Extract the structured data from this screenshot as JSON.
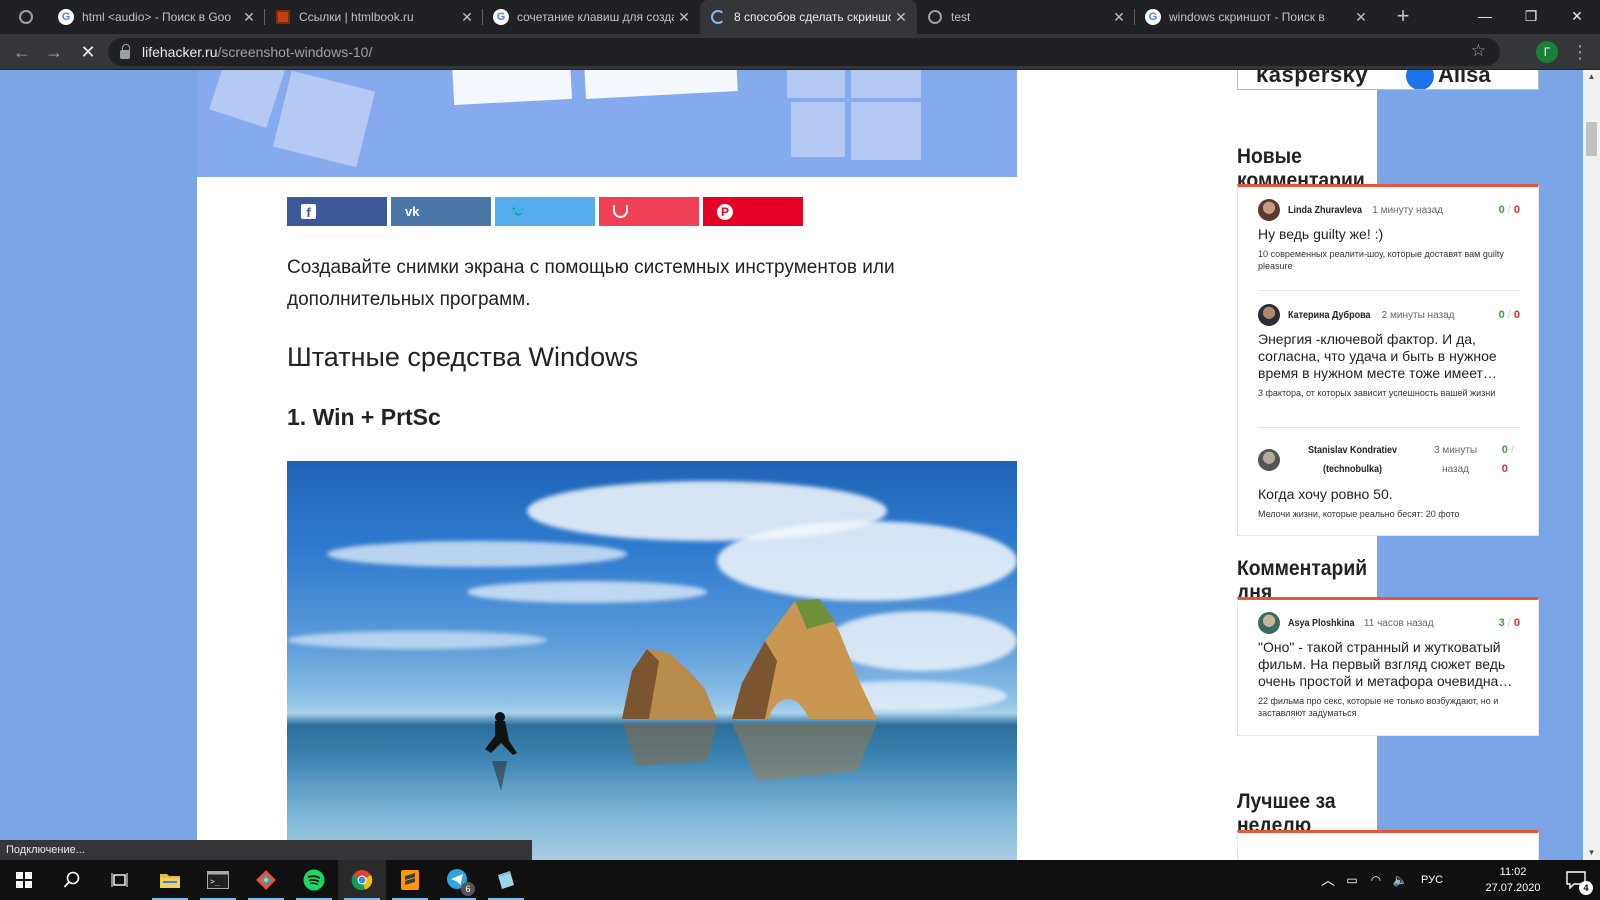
{
  "browser": {
    "tabs": [
      {
        "title": "html <audio> - Поиск в Goo",
        "icon": "google-icon",
        "active": false
      },
      {
        "title": "Ссылки | htmlbook.ru",
        "icon": "htmlbook-icon",
        "active": false
      },
      {
        "title": "сочетание клавиш для созда",
        "icon": "google-icon",
        "active": false
      },
      {
        "title": "8 способов сделать скриншо",
        "icon": "loading-spinner-icon",
        "active": true
      },
      {
        "title": "test",
        "icon": "globe-icon",
        "active": false
      },
      {
        "title": "windows скриншот - Поиск в",
        "icon": "google-icon",
        "active": false
      }
    ],
    "address": {
      "domain": "lifehacker.ru",
      "path": "/screenshot-windows-10/"
    },
    "profile_initial": "Г",
    "status_text": "Подключение..."
  },
  "article": {
    "share_buttons": [
      {
        "network": "facebook",
        "glyph": "f",
        "color": "#3b5998"
      },
      {
        "network": "vk",
        "glyph": "vk",
        "color": "#4a76a8"
      },
      {
        "network": "twitter",
        "glyph": "t",
        "color": "#55acee"
      },
      {
        "network": "pocket",
        "glyph": "❤",
        "color": "#ef4056"
      },
      {
        "network": "pinterest",
        "glyph": "P",
        "color": "#e60023"
      }
    ],
    "lead": "Создавайте снимки экрана с помощью системных инструментов или дополнительных программ.",
    "h2": "Штатные средства Windows",
    "h3": "1. Win + PrtSc"
  },
  "sidebar": {
    "banner": {
      "left": "kaspersky",
      "right": "Alisa"
    },
    "new_comments": {
      "title": "Новые комментарии",
      "items": [
        {
          "author": "Linda Zhuravleva",
          "time": "1 минуту назад",
          "up": "0",
          "down": "0",
          "text": "Ну ведь guilty же! :)",
          "source": "10 современных реалити-шоу, которые доставят вам guilty pleasure"
        },
        {
          "author": "Катерина Дуброва",
          "time": "2 минуты назад",
          "up": "0",
          "down": "0",
          "text": "Энергия -ключевой фактор. И да, согласна, что удача и быть в нужное время в нужном месте тоже имеет…",
          "source": "3 фактора, от которых зависит успешность вашей жизни"
        },
        {
          "author_line1": "Stanislav Kondratiev",
          "author_line2": "(technobulka)",
          "time_line1": "3 минуты",
          "time_line2": "назад",
          "up": "0",
          "down": "0",
          "text": "Когда хочу ровно 50.",
          "source": "Мелочи жизни, которые реально бесят: 20 фото"
        }
      ]
    },
    "comment_of_day": {
      "title": "Комментарий дня",
      "item": {
        "author": "Asya Ploshkina",
        "time": "11 часов назад",
        "up": "3",
        "down": "0",
        "text": "\"Оно\" - такой странный и жутковатый фильм. На первый взгляд сюжет ведь очень простой и метафора очевидна…",
        "source": "22 фильма про секс, которые не только возбуждают, но и заставляют задуматься"
      }
    },
    "best_week": {
      "title": "Лучшее за неделю"
    }
  },
  "taskbar": {
    "apps": [
      "start-icon",
      "search-icon",
      "task-view-icon",
      "file-explorer-icon",
      "terminal-icon",
      "git-icon",
      "spotify-icon",
      "chrome-icon",
      "sublime-icon",
      "telegram-icon",
      "notepad-icon"
    ],
    "telegram_badge": "6",
    "language": "РУС",
    "time": "11:02",
    "date": "27.07.2020",
    "notification_count": "4"
  }
}
